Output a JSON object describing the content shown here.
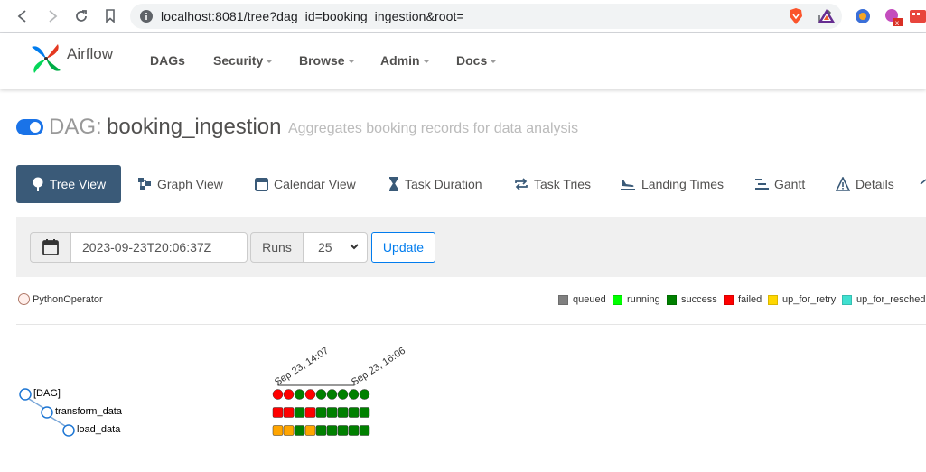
{
  "browser": {
    "url": "localhost:8081/tree?dag_id=booking_ingestion&root="
  },
  "navbar": {
    "brand": "Airflow",
    "menu": [
      {
        "label": "DAGs",
        "has_caret": false
      },
      {
        "label": "Security",
        "has_caret": true
      },
      {
        "label": "Browse",
        "has_caret": true
      },
      {
        "label": "Admin",
        "has_caret": true
      },
      {
        "label": "Docs",
        "has_caret": true
      }
    ]
  },
  "dag": {
    "prefix": "DAG:",
    "name": "booking_ingestion",
    "description": "Aggregates booking records for data analysis",
    "paused": false
  },
  "tabs": [
    {
      "label": "Tree View",
      "icon": "tree-icon",
      "active": true
    },
    {
      "label": "Graph View",
      "icon": "graph-icon",
      "active": false
    },
    {
      "label": "Calendar View",
      "icon": "calendar-icon",
      "active": false
    },
    {
      "label": "Task Duration",
      "icon": "hourglass-icon",
      "active": false
    },
    {
      "label": "Task Tries",
      "icon": "repeat-icon",
      "active": false
    },
    {
      "label": "Landing Times",
      "icon": "plane-landing-icon",
      "active": false
    },
    {
      "label": "Gantt",
      "icon": "gantt-icon",
      "active": false
    },
    {
      "label": "Details",
      "icon": "warning-triangle-icon",
      "active": false
    }
  ],
  "controls": {
    "base_date": "2023-09-23T20:06:37Z",
    "runs_label": "Runs",
    "runs_value": "25",
    "update_label": "Update"
  },
  "legend": {
    "operator": {
      "label": "PythonOperator",
      "fill": "#ffefeb",
      "stroke": "#b07a6a"
    },
    "states": [
      {
        "label": "queued",
        "color": "#808080"
      },
      {
        "label": "running",
        "color": "#00ff00"
      },
      {
        "label": "success",
        "color": "#008000"
      },
      {
        "label": "failed",
        "color": "#ff0000"
      },
      {
        "label": "up_for_retry",
        "color": "#ffd700"
      },
      {
        "label": "up_for_reschedu",
        "color": "#40e0d0"
      }
    ]
  },
  "tree": {
    "run_dates": [
      "Sep 23, 14:07",
      "Sep 23, 16:06"
    ],
    "tasks": [
      {
        "label": "[DAG]",
        "depth": 0,
        "kind": "dag",
        "states": [
          "failed",
          "failed",
          "success",
          "failed",
          "success",
          "success",
          "success",
          "success",
          "success"
        ]
      },
      {
        "label": "transform_data",
        "depth": 1,
        "kind": "task",
        "states": [
          "failed",
          "failed",
          "success",
          "failed",
          "success",
          "success",
          "success",
          "success",
          "success"
        ]
      },
      {
        "label": "load_data",
        "depth": 2,
        "kind": "task",
        "states": [
          "upstream_failed",
          "upstream_failed",
          "success",
          "upstream_failed",
          "success",
          "success",
          "success",
          "success",
          "success"
        ]
      }
    ],
    "state_colors": {
      "success": "#008000",
      "failed": "#ff0000",
      "upstream_failed": "#ffa500"
    }
  }
}
